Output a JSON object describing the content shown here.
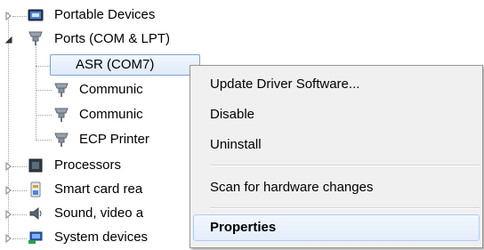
{
  "tree": {
    "items": [
      {
        "label": "Portable Devices",
        "icon": "portable-device-icon",
        "expander": "collapsed"
      },
      {
        "label": "Ports (COM & LPT)",
        "icon": "port-icon",
        "expander": "expanded"
      },
      {
        "label": "ASR (COM7)",
        "icon": "port-icon",
        "selected": true
      },
      {
        "label": "Communic",
        "icon": "port-icon"
      },
      {
        "label": "Communic",
        "icon": "port-icon"
      },
      {
        "label": "ECP Printer",
        "icon": "port-icon"
      },
      {
        "label": "Processors",
        "icon": "processor-icon",
        "expander": "collapsed"
      },
      {
        "label": "Smart card rea",
        "icon": "smart-card-reader-icon",
        "expander": "collapsed"
      },
      {
        "label": "Sound, video a",
        "icon": "sound-icon",
        "expander": "collapsed"
      },
      {
        "label": "System devices",
        "icon": "system-device-icon",
        "expander": "collapsed"
      }
    ]
  },
  "context_menu": {
    "items": [
      {
        "label": "Update Driver Software..."
      },
      {
        "label": "Disable"
      },
      {
        "label": "Uninstall"
      },
      {
        "label": "Scan for hardware changes"
      },
      {
        "label": "Properties",
        "default": true,
        "highlighted": true
      }
    ]
  },
  "colors": {
    "selection_border": "#7da2ce",
    "menu_background": "#f0f0f0",
    "menu_border": "#979797",
    "hover_border": "#aecff7"
  }
}
